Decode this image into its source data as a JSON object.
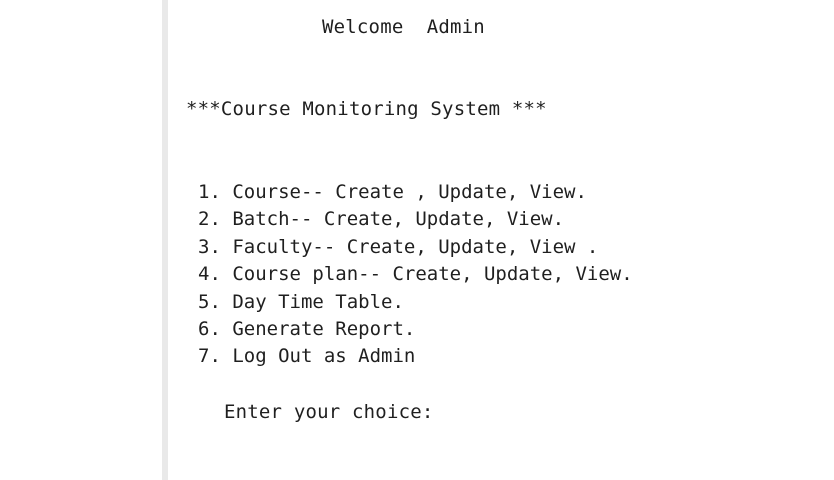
{
  "console": {
    "welcome": "Welcome  Admin",
    "system_title": "***Course Monitoring System ***",
    "menu_items": [
      "1. Course-- Create , Update, View.",
      "2. Batch-- Create, Update, View.",
      "3. Faculty-- Create, Update, View .",
      "4. Course plan-- Create, Update, View.",
      "5. Day Time Table.",
      "6. Generate Report.",
      "7. Log Out as Admin"
    ],
    "prompt": "Enter your choice:"
  }
}
